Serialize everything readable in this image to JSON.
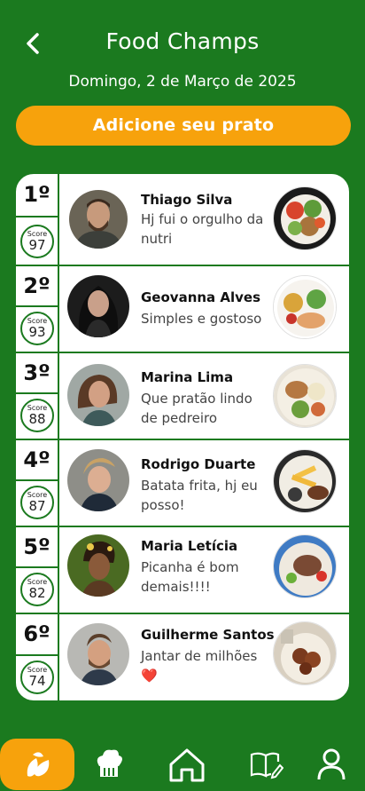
{
  "header": {
    "title": "Food Champs",
    "date": "Domingo, 2 de Março de 2025",
    "back_icon": "chevron-left-icon"
  },
  "actions": {
    "add_dish_label": "Adicione seu prato"
  },
  "ranking": {
    "score_label": "Score",
    "entries": [
      {
        "rank": "1º",
        "score": "97",
        "name": "Thiago Silva",
        "comment": "Hj fui o orgulho da nutri"
      },
      {
        "rank": "2º",
        "score": "93",
        "name": "Geovanna Alves",
        "comment": "Simples e gostoso"
      },
      {
        "rank": "3º",
        "score": "88",
        "name": "Marina Lima",
        "comment": "Que pratão lindo de pedreiro"
      },
      {
        "rank": "4º",
        "score": "87",
        "name": "Rodrigo Duarte",
        "comment": "Batata frita, hj eu posso!"
      },
      {
        "rank": "5º",
        "score": "82",
        "name": "Maria Letícia",
        "comment": "Picanha é bom demais!!!!"
      },
      {
        "rank": "6º",
        "score": "74",
        "name": "Guilherme Santos",
        "comment": "Jantar de milhões ❤️"
      }
    ]
  },
  "bottom_nav": {
    "items": [
      {
        "icon": "leaf-icon",
        "active": true
      },
      {
        "icon": "chef-hat-icon",
        "active": false
      },
      {
        "icon": "home-icon",
        "active": false
      },
      {
        "icon": "book-icon",
        "active": false
      },
      {
        "icon": "user-icon",
        "active": false
      }
    ]
  },
  "colors": {
    "background": "#1b7a1f",
    "accent": "#f7a20c",
    "card": "#ffffff"
  }
}
